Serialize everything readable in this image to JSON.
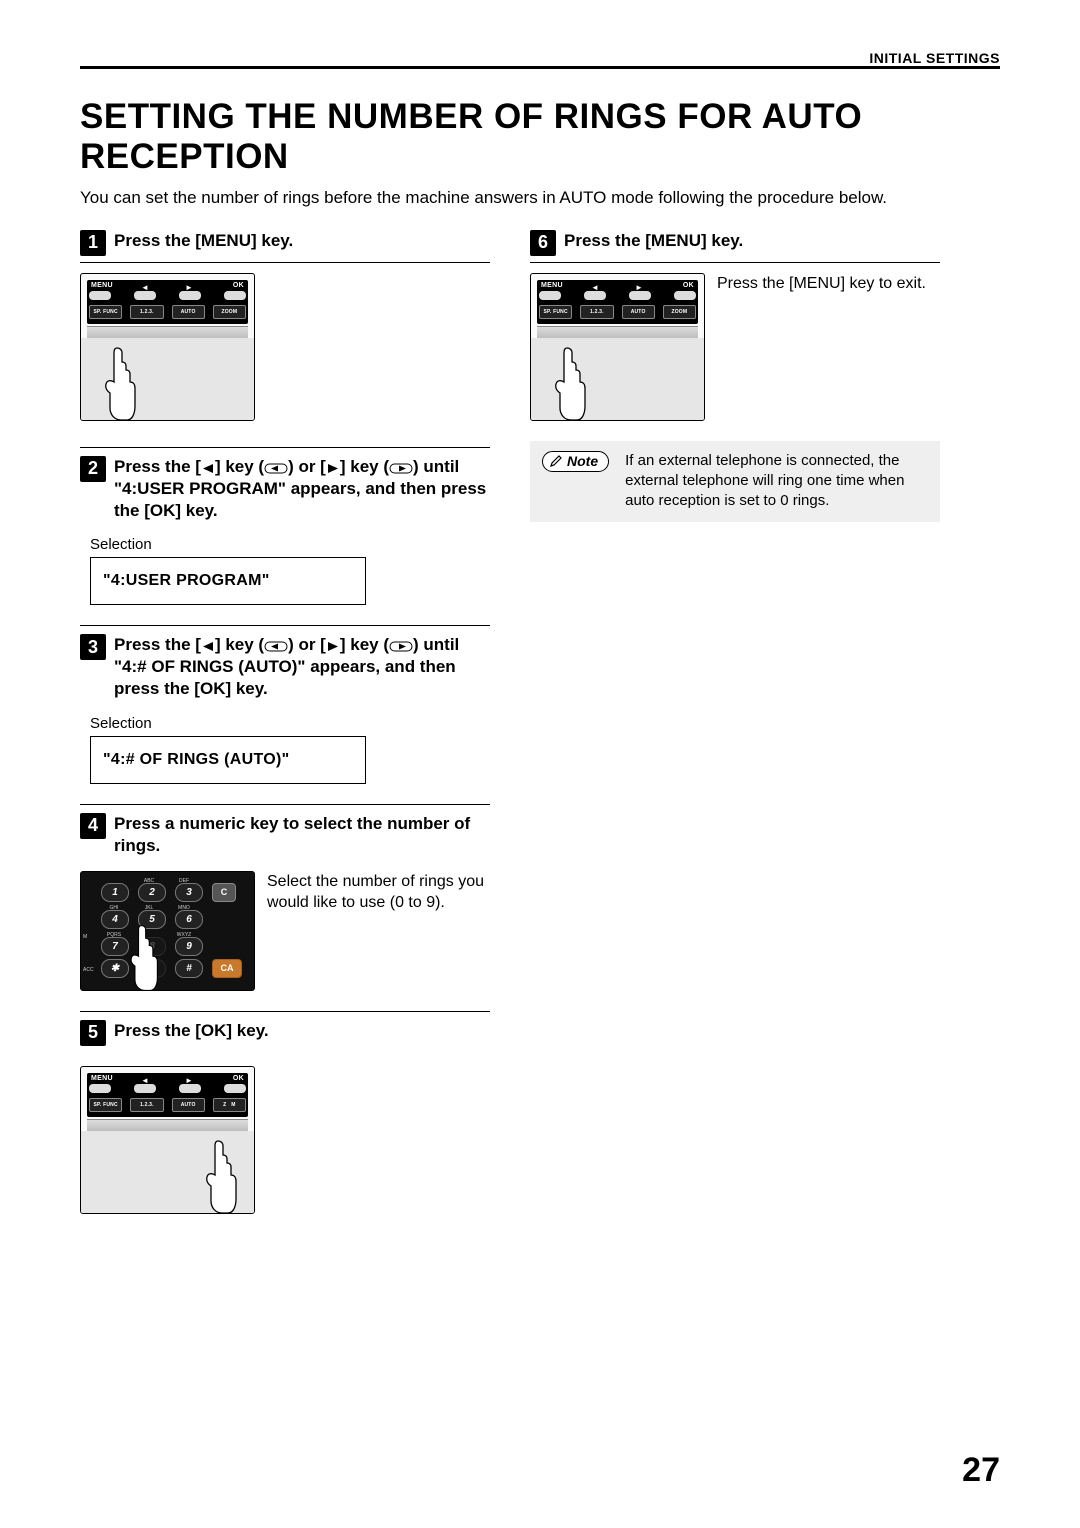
{
  "header": {
    "section": "INITIAL SETTINGS"
  },
  "title": "SETTING THE NUMBER OF RINGS FOR AUTO RECEPTION",
  "intro": "You can set the number of rings before the machine answers in AUTO mode following the procedure below.",
  "page_number": "27",
  "panel_labels": {
    "menu": "MENU",
    "ok": "OK",
    "sp_func": "SP. FUNC",
    "auto": "AUTO",
    "zoom": "ZOOM"
  },
  "keypad_labels": {
    "abc": "ABC",
    "def": "DEF",
    "ghi": "GHI",
    "jkl": "JKL",
    "mno": "MNO",
    "pqrs": "PQRS",
    "wxyz": "WXYZ",
    "c": "C",
    "ca": "CA",
    "acc": "ACC"
  },
  "steps": {
    "s1": {
      "num": "1",
      "title": "Press the [MENU] key."
    },
    "s2": {
      "num": "2",
      "title_pre": "Press the [",
      "title_mid1": "] key (",
      "title_mid2": ") or [",
      "title_mid3": "] key (",
      "title_post": ") until \"4:USER PROGRAM\" appears, and then press the [OK] key.",
      "selection_label": "Selection",
      "lcd": "\"4:USER PROGRAM\""
    },
    "s3": {
      "num": "3",
      "title_pre": "Press the [",
      "title_mid1": "] key (",
      "title_mid2": ") or [",
      "title_mid3": "] key (",
      "title_post": ") until \"4:# OF RINGS (AUTO)\" appears, and then press the [OK] key.",
      "selection_label": "Selection",
      "lcd": "\"4:# OF RINGS (AUTO)\""
    },
    "s4": {
      "num": "4",
      "title": "Press a numeric key to select the number of rings.",
      "desc": "Select the number of rings you would like to use (0 to 9)."
    },
    "s5": {
      "num": "5",
      "title": "Press the [OK] key."
    },
    "s6": {
      "num": "6",
      "title": "Press the [MENU] key.",
      "desc": "Press the [MENU] key to exit."
    }
  },
  "note": {
    "label": "Note",
    "text": "If an external telephone is connected, the external telephone will ring one time when auto reception is set to 0 rings."
  }
}
